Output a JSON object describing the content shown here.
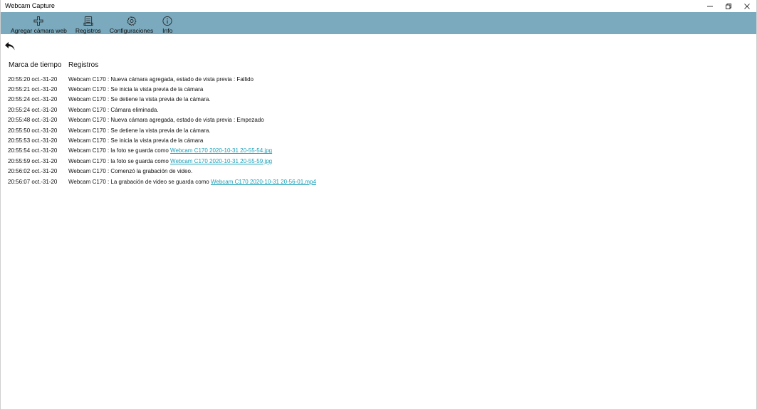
{
  "window": {
    "title": "Webcam Capture"
  },
  "toolbar": {
    "items": [
      {
        "label": "Agregar cámara web",
        "icon": "plus-icon"
      },
      {
        "label": "Registros",
        "icon": "log-icon"
      },
      {
        "label": "Configuraciones",
        "icon": "gear-icon"
      },
      {
        "label": "Info",
        "icon": "info-icon"
      }
    ]
  },
  "log": {
    "headers": {
      "time": "Marca de tiempo",
      "message": "Registros"
    },
    "rows": [
      {
        "time": "20:55:20 oct.-31-20",
        "message": "Webcam C170 : Nueva cámara agregada, estado de vista previa : Fallido",
        "link": ""
      },
      {
        "time": "20:55:21 oct.-31-20",
        "message": "Webcam C170 : Se inicia la vista previa de la cámara",
        "link": ""
      },
      {
        "time": "20:55:24 oct.-31-20",
        "message": "Webcam C170 : Se detiene la vista previa de la cámara.",
        "link": ""
      },
      {
        "time": "20:55:24 oct.-31-20",
        "message": "Webcam C170 : Cámara eliminada.",
        "link": ""
      },
      {
        "time": "20:55:48 oct.-31-20",
        "message": "Webcam C170 : Nueva cámara agregada, estado de vista previa : Empezado",
        "link": ""
      },
      {
        "time": "20:55:50 oct.-31-20",
        "message": "Webcam C170 : Se detiene la vista previa de la cámara.",
        "link": ""
      },
      {
        "time": "20:55:53 oct.-31-20",
        "message": "Webcam C170 : Se inicia la vista previa de la cámara",
        "link": ""
      },
      {
        "time": "20:55:54 oct.-31-20",
        "message": "Webcam C170 : la foto se guarda como ",
        "link": "Webcam C170 2020-10-31 20-55-54.jpg"
      },
      {
        "time": "20:55:59 oct.-31-20",
        "message": "Webcam C170 : la foto se guarda como ",
        "link": "Webcam C170 2020-10-31 20-55-59.jpg"
      },
      {
        "time": "20:56:02 oct.-31-20",
        "message": "Webcam C170 : Comenzó la grabación de video.",
        "link": ""
      },
      {
        "time": "20:56:07 oct.-31-20",
        "message": "Webcam C170 : La grabación de video se guarda como ",
        "link": "Webcam C170 2020-10-31 20-56-01.mp4"
      }
    ]
  },
  "colors": {
    "toolbar_bg": "#7ba9bd",
    "link": "#1a9fb7"
  }
}
